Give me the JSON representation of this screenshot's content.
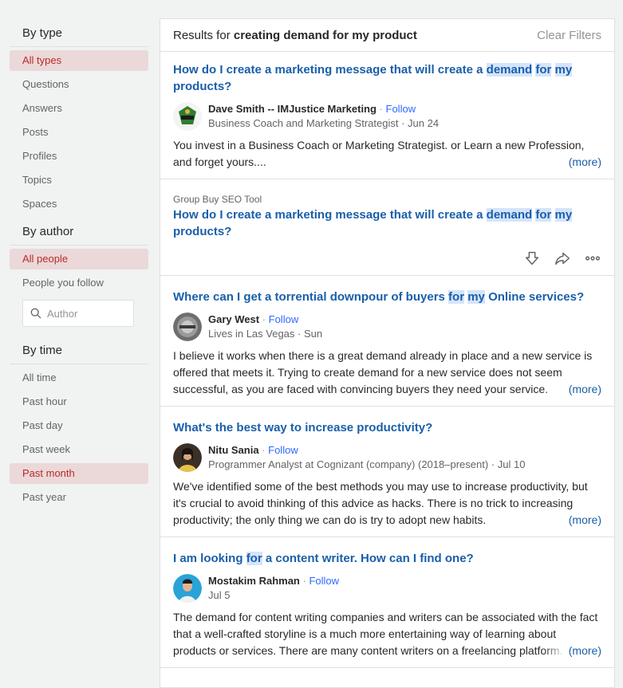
{
  "sidebar": {
    "by_type": {
      "title": "By type",
      "items": [
        "All types",
        "Questions",
        "Answers",
        "Posts",
        "Profiles",
        "Topics",
        "Spaces"
      ]
    },
    "by_author": {
      "title": "By author",
      "items": [
        "All people",
        "People you follow"
      ],
      "author_placeholder": "Author"
    },
    "by_time": {
      "title": "By time",
      "items": [
        "All time",
        "Past hour",
        "Past day",
        "Past week",
        "Past month",
        "Past year"
      ]
    }
  },
  "results": {
    "prefix": "Results for ",
    "query": "creating demand for my product",
    "clear_label": "Clear Filters"
  },
  "items": [
    {
      "title_parts": [
        "How do I create a marketing message that will create a ",
        "demand",
        " ",
        "for",
        " ",
        "my",
        " products?"
      ],
      "author": "Dave Smith -- IMJustice Marketing",
      "follow": "Follow",
      "credential": "Business Coach and Marketing Strategist",
      "date": "Jun 24",
      "snippet": "You invest in a Business Coach or Marketing Strategist. or Learn a new Profession, and forget yours....",
      "more": "(more)"
    },
    {
      "ad_label": "Group Buy SEO Tool",
      "title_parts": [
        "How do I create a marketing message that will create a ",
        "demand",
        " ",
        "for",
        " ",
        "my",
        " products?"
      ]
    },
    {
      "title_parts": [
        "Where can I get a torrential downpour of buyers ",
        "for",
        " ",
        "my",
        " Online services?"
      ],
      "author": "Gary West",
      "follow": "Follow",
      "credential": "Lives in Las Vegas",
      "date": "Sun",
      "snippet": "I believe it works when there is a great demand already in place and a new service is offered that meets it. Trying to create demand for a new service does not seem successful, as you are faced with convincing buyers they need your service.",
      "more": "(more)"
    },
    {
      "title_parts": [
        "What's the best way to increase productivity?"
      ],
      "author": "Nitu Sania",
      "follow": "Follow",
      "credential": "Programmer Analyst at Cognizant (company) (2018–present)",
      "date": "Jul 10",
      "snippet": "We've identified some of the best methods you may use to increase productivity, but it's crucial to avoid thinking of this advice as hacks. There is no trick to increasing productivity; the only thing we can do is try to adopt new habits.",
      "more": "(more)"
    },
    {
      "title_parts": [
        "I am looking ",
        "for",
        " a content writer. How can I find one?"
      ],
      "author": "Mostakim Rahman",
      "follow": "Follow",
      "date": "Jul 5",
      "snippet": "The demand for content writing companies and writers can be associated with the fact that a well-crafted storyline is a much more entertaining way of learning about products or services. There are many content writers on a freelancing platform.",
      "more": "(more)"
    }
  ],
  "separator": " · "
}
